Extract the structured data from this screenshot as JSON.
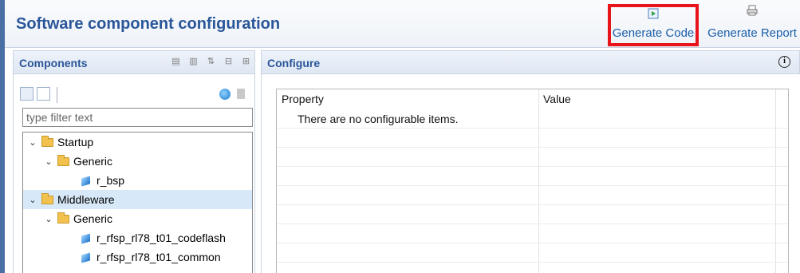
{
  "header": {
    "title": "Software component configuration",
    "generate_code_label": "Generate Code",
    "generate_report_label": "Generate Report",
    "highlight_color": "#e8141b"
  },
  "components": {
    "title": "Components",
    "filter_placeholder": "type filter text",
    "toolbar_icons": [
      "collapse-all-icon",
      "expand-all-icon",
      "sort-alpha-icon",
      "collapse-icon",
      "expand-icon"
    ],
    "tree": [
      {
        "label": "Startup",
        "type": "folder",
        "level": 0,
        "expanded": true
      },
      {
        "label": "Generic",
        "type": "folder",
        "level": 1,
        "expanded": true
      },
      {
        "label": "r_bsp",
        "type": "component",
        "level": 2
      },
      {
        "label": "Middleware",
        "type": "folder",
        "level": 0,
        "expanded": true,
        "selected": true
      },
      {
        "label": "Generic",
        "type": "folder",
        "level": 1,
        "expanded": true
      },
      {
        "label": "r_rfsp_rl78_t01_codeflash",
        "type": "component",
        "level": 2
      },
      {
        "label": "r_rfsp_rl78_t01_common",
        "type": "component",
        "level": 2
      }
    ]
  },
  "configure": {
    "title": "Configure",
    "columns": [
      "Property",
      "Value"
    ],
    "empty_message": "There are no configurable items."
  }
}
